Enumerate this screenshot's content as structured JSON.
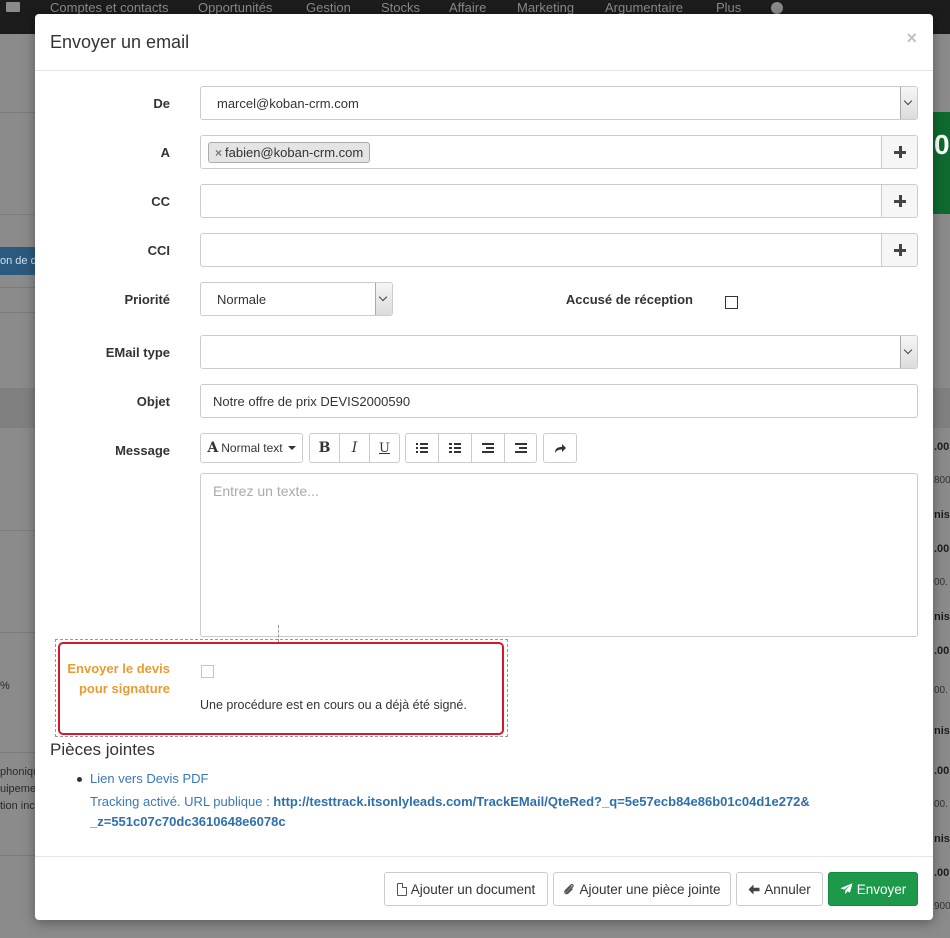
{
  "background": {
    "nav_items": [
      "Comptes et contacts",
      "Opportunités",
      "Gestion",
      "Stocks",
      "Affaire",
      "Marketing",
      "Argumentaire",
      "Plus"
    ],
    "green_tile_text": "0",
    "blue_button_text": "on de d",
    "left_snippets": [
      "%",
      "phoniqu",
      "uipeme",
      "tion inc"
    ],
    "right_snippets": [
      ".00",
      "800",
      "niss",
      ".00",
      "00.",
      "niss",
      ".00",
      "00.",
      "niss",
      ".00",
      "00.",
      "niss",
      ".00",
      "900"
    ]
  },
  "modal": {
    "title": "Envoyer un email",
    "close_label": "×",
    "fields": {
      "from_label": "De",
      "from_value": "marcel@koban-crm.com",
      "to_label": "A",
      "to_tag": "fabien@koban-crm.com",
      "to_tag_remove": "×",
      "cc_label": "CC",
      "cci_label": "CCI",
      "priority_label": "Priorité",
      "priority_value": "Normale",
      "receipt_label": "Accusé de réception",
      "email_type_label": "EMail type",
      "email_type_value": "",
      "subject_label": "Objet",
      "subject_value": "Notre offre de prix DEVIS2000590",
      "message_label": "Message"
    },
    "editor": {
      "font_style_label": "Normal text",
      "placeholder": "Entrez un texte..."
    },
    "signature": {
      "label_line1": "Envoyer le devis",
      "label_line2": "pour signature",
      "note": "Une procédure est en cours ou a déjà été signé."
    },
    "attachments": {
      "title": "Pièces jointes",
      "link_text": "Lien vers Devis PDF",
      "tracking_prefix": "Tracking activé. URL publique : ",
      "tracking_url_line1": "http://testtrack.itsonlyleads.com/TrackEMail/QteRed?_q=5e57ecb84e86b01c04d1e272&",
      "tracking_url_line2": "_z=551c07c70dc3610648e6078c"
    },
    "footer": {
      "add_document": "Ajouter un document",
      "add_attachment": "Ajouter une pièce jointe",
      "cancel": "Annuler",
      "send": "Envoyer"
    }
  },
  "colors": {
    "primary_green": "#1c9a4a",
    "link_blue": "#3a78b5",
    "signature_orange": "#e89b33",
    "highlight_red": "#d9152b"
  }
}
